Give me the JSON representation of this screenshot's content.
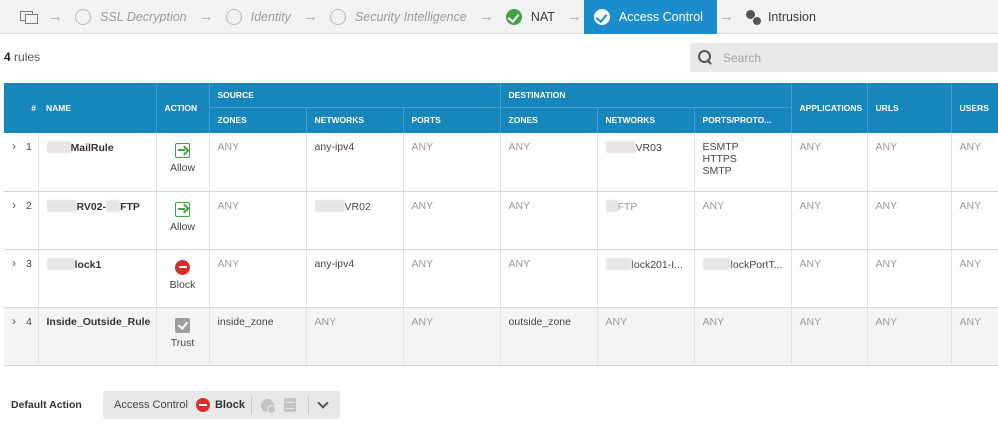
{
  "wizard": {
    "steps": [
      {
        "label": "SSL Decryption",
        "state": "inactive"
      },
      {
        "label": "Identity",
        "state": "inactive"
      },
      {
        "label": "Security Intelligence",
        "state": "inactive"
      },
      {
        "label": "NAT",
        "state": "done"
      },
      {
        "label": "Access Control",
        "state": "active"
      },
      {
        "label": "Intrusion",
        "state": "plain"
      }
    ],
    "arrow": "→"
  },
  "summary": {
    "count": "4",
    "suffix": "rules"
  },
  "search": {
    "placeholder": "Search",
    "value": ""
  },
  "table": {
    "group_headers": {
      "source": "SOURCE",
      "destination": "DESTINATION"
    },
    "headers": {
      "num": "#",
      "name": "NAME",
      "action": "ACTION",
      "src_zones": "ZONES",
      "src_networks": "NETWORKS",
      "src_ports": "PORTS",
      "dst_zones": "ZONES",
      "dst_networks": "NETWORKS",
      "dst_ports": "PORTS/PROTO...",
      "applications": "APPLICATIONS",
      "urls": "URLS",
      "users": "USERS"
    },
    "rows": [
      {
        "num": "1",
        "name": "MailRule",
        "action": "Allow",
        "src_zones": "ANY",
        "src_networks": "any-ipv4",
        "src_ports": "ANY",
        "dst_zones": "ANY",
        "dst_networks": "VR03",
        "dst_ports": [
          "ESMTP",
          "HTTPS",
          "SMTP"
        ],
        "applications": "ANY",
        "urls": "ANY",
        "users": "ANY"
      },
      {
        "num": "2",
        "name": "RV02-",
        "name_tail": "FTP",
        "action": "Allow",
        "src_zones": "ANY",
        "src_networks": "VR02",
        "src_ports": "ANY",
        "dst_zones": "ANY",
        "dst_networks": "FTP",
        "dst_ports": "ANY",
        "applications": "ANY",
        "urls": "ANY",
        "users": "ANY"
      },
      {
        "num": "3",
        "name": "lock1",
        "action": "Block",
        "src_zones": "ANY",
        "src_networks": "any-ipv4",
        "src_ports": "ANY",
        "dst_zones": "ANY",
        "dst_networks": "lock201-I...",
        "dst_ports": "lockPortT...",
        "applications": "ANY",
        "urls": "ANY",
        "users": "ANY"
      },
      {
        "num": "4",
        "name": "Inside_Outside_Rule",
        "action": "Trust",
        "src_zones": "inside_zone",
        "src_networks": "ANY",
        "src_ports": "ANY",
        "dst_zones": "outside_zone",
        "dst_networks": "ANY",
        "dst_ports": "ANY",
        "applications": "ANY",
        "urls": "ANY",
        "users": "ANY"
      }
    ]
  },
  "default_action": {
    "label": "Default Action",
    "policy": "Access Control",
    "value": "Block"
  },
  "colors": {
    "header_blue": "#1786bd",
    "active_step": "#1c8dcc",
    "done_green": "#43a047",
    "block_red": "#d32f2f"
  }
}
